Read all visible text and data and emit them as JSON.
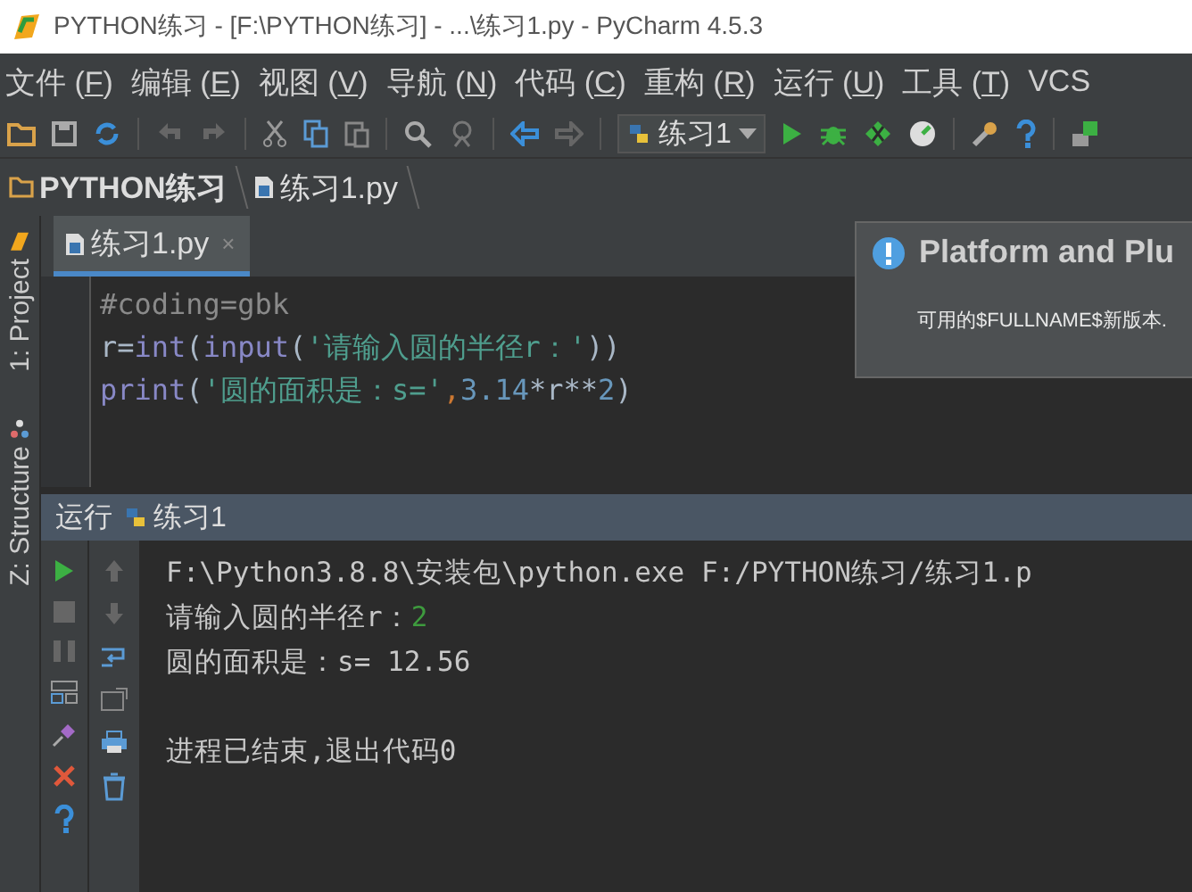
{
  "window": {
    "title": "PYTHON练习 - [F:\\PYTHON练习] - ...\\练习1.py - PyCharm 4.5.3"
  },
  "menu": [
    {
      "before": "文件 (",
      "mnemonic": "F",
      "after": ")"
    },
    {
      "before": "编辑 (",
      "mnemonic": "E",
      "after": ")"
    },
    {
      "before": "视图 (",
      "mnemonic": "V",
      "after": ")"
    },
    {
      "before": "导航 (",
      "mnemonic": "N",
      "after": ")"
    },
    {
      "before": "代码 (",
      "mnemonic": "C",
      "after": ")"
    },
    {
      "before": "重构 (",
      "mnemonic": "R",
      "after": ")"
    },
    {
      "before": "运行 (",
      "mnemonic": "U",
      "after": ")"
    },
    {
      "before": "工具 (",
      "mnemonic": "T",
      "after": ")"
    },
    {
      "before": "VCS"
    }
  ],
  "toolbar": {
    "run_config": "练习1"
  },
  "breadcrumb": [
    "PYTHON练习",
    "练习1.py"
  ],
  "side_tabs": [
    {
      "label": "1: Project",
      "kind": "project"
    },
    {
      "label": "Z: Structure",
      "kind": "structure"
    }
  ],
  "editor_tabs": [
    {
      "label": "练习1.py",
      "close": "×",
      "selected": true
    }
  ],
  "code": [
    [
      {
        "kind": "comment",
        "text": "#coding=gbk"
      }
    ],
    [
      {
        "kind": "plain",
        "text": "r="
      },
      {
        "kind": "builtin",
        "text": "int"
      },
      {
        "kind": "plain",
        "text": "("
      },
      {
        "kind": "builtin",
        "text": "input"
      },
      {
        "kind": "plain",
        "text": "("
      },
      {
        "kind": "string",
        "text": "'请输入圆的半径r：'"
      },
      {
        "kind": "plain",
        "text": "))"
      }
    ],
    [
      {
        "kind": "builtin",
        "text": "print"
      },
      {
        "kind": "plain",
        "text": "("
      },
      {
        "kind": "string",
        "text": "'圆的面积是：s='"
      },
      {
        "kind": "punct",
        "text": ","
      },
      {
        "kind": "number",
        "text": "3.14"
      },
      {
        "kind": "plain",
        "text": "*r**"
      },
      {
        "kind": "number",
        "text": "2"
      },
      {
        "kind": "plain",
        "text": ")"
      }
    ]
  ],
  "notification": {
    "title": "Platform and Plu",
    "body": "可用的$FULLNAME$新版本."
  },
  "run_panel": {
    "label": "运行",
    "config": "练习1"
  },
  "console_blocks": [
    [
      [
        {
          "kind": "output",
          "text": "F:\\Python3.8.8\\安装包\\python.exe F:/PYTHON练习/练习1.p"
        }
      ],
      [
        {
          "kind": "output",
          "text": "请输入圆的半径r："
        },
        {
          "kind": "input",
          "text": "2"
        }
      ],
      [
        {
          "kind": "output",
          "text": "圆的面积是：s= 12.56"
        }
      ]
    ],
    [
      [
        {
          "kind": "output",
          "text": "进程已结束,退出代码0"
        }
      ]
    ]
  ]
}
